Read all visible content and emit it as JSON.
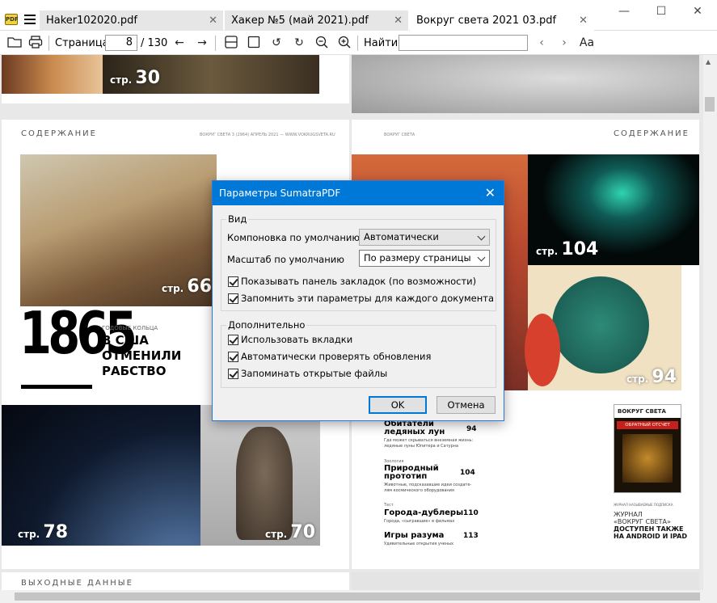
{
  "app": {
    "icon_text": "PDF"
  },
  "tabs": [
    {
      "label": "Haker102020.pdf"
    },
    {
      "label": "Хакер №5 (май 2021).pdf"
    },
    {
      "label": "Вокруг света 2021 03.pdf"
    }
  ],
  "window": {
    "minimize": "—",
    "maximize": "☐",
    "close": "✕"
  },
  "toolbar": {
    "page_label": "Страница:",
    "page_value": "8",
    "page_total": "/ 130",
    "find_label": "Найти:",
    "find_value": ""
  },
  "dialog": {
    "title": "Параметры SumatraPDF",
    "group_view": "Вид",
    "layout_label": "Компоновка по умолчанию",
    "layout_value": "Автоматически",
    "zoom_label": "Масштаб по умолчанию",
    "zoom_value": "По размеру страницы",
    "chk_bookmarks": "Показывать панель закладок (по возможности)",
    "chk_remember": "Запомнить эти параметры для каждого документа",
    "group_extra": "Дополнительно",
    "chk_tabs": "Использовать вкладки",
    "chk_updates": "Автоматически проверять обновления",
    "chk_files": "Запоминать открытые файлы",
    "ok": "OK",
    "cancel": "Отмена"
  },
  "pages": {
    "left_header": "СОДЕРЖАНИЕ",
    "left_header_small": "ВОКРУГ СВЕТА 3 (2964) АПРЕЛЬ 2021 — WWW.VOKRUGSVETA.RU",
    "right_header": "СОДЕРЖАНИЕ",
    "right_header_small": "ВОКРУГ СВЕТА",
    "year": "1865",
    "year_kicker": "ГОДОВЫЕ КОЛЬЦА",
    "year_title_1": "В США",
    "year_title_2": "ОТМЕНИЛИ",
    "year_title_3": "РАБСТВО",
    "footer_left": "ВЫХОДНЫЕ ДАННЫЕ",
    "badges": [
      {
        "s": "стр.",
        "n": "30"
      },
      {
        "s": "стр.",
        "n": "66"
      },
      {
        "s": "стр.",
        "n": "78"
      },
      {
        "s": "стр.",
        "n": "70"
      },
      {
        "s": "стр.",
        "n": "104"
      },
      {
        "s": "стр.",
        "n": "94"
      }
    ],
    "toc": [
      {
        "title": "Обитатели",
        "title2": "ледяных лун",
        "page": "94",
        "desc": "Где может скрываться внеземная жизнь:",
        "desc2": "ледяные луны Юпитера и Сатурна"
      },
      {
        "kicker": "Зоология",
        "title": "Природный",
        "title2": "прототип",
        "page": "104",
        "desc": "Животные, подсказавшие идеи создате-",
        "desc2": "лям космического оборудования"
      },
      {
        "kicker": "Тест",
        "title": "Города-дублеры",
        "page": "110",
        "desc": "Города, «сыгравшие» в фильмах"
      },
      {
        "title": "Игры разума",
        "page": "113",
        "desc": "Удивительные открытия ученых"
      }
    ],
    "magazine_logo": "ВОКРУГ СВЕТА",
    "magazine_cover_title": "ОБРАТНЫЙ ОТСЧЕТ",
    "promo_small": "ЖУРНАЛ НАЗЫВАЕМЫЕ ПОДПИСКА",
    "promo_1": "ЖУРНАЛ",
    "promo_2": "«ВОКРУГ СВЕТА»",
    "promo_3": "ДОСТУПЕН ТАКЖЕ",
    "promo_4": "НА ANDROID И IPAD"
  }
}
